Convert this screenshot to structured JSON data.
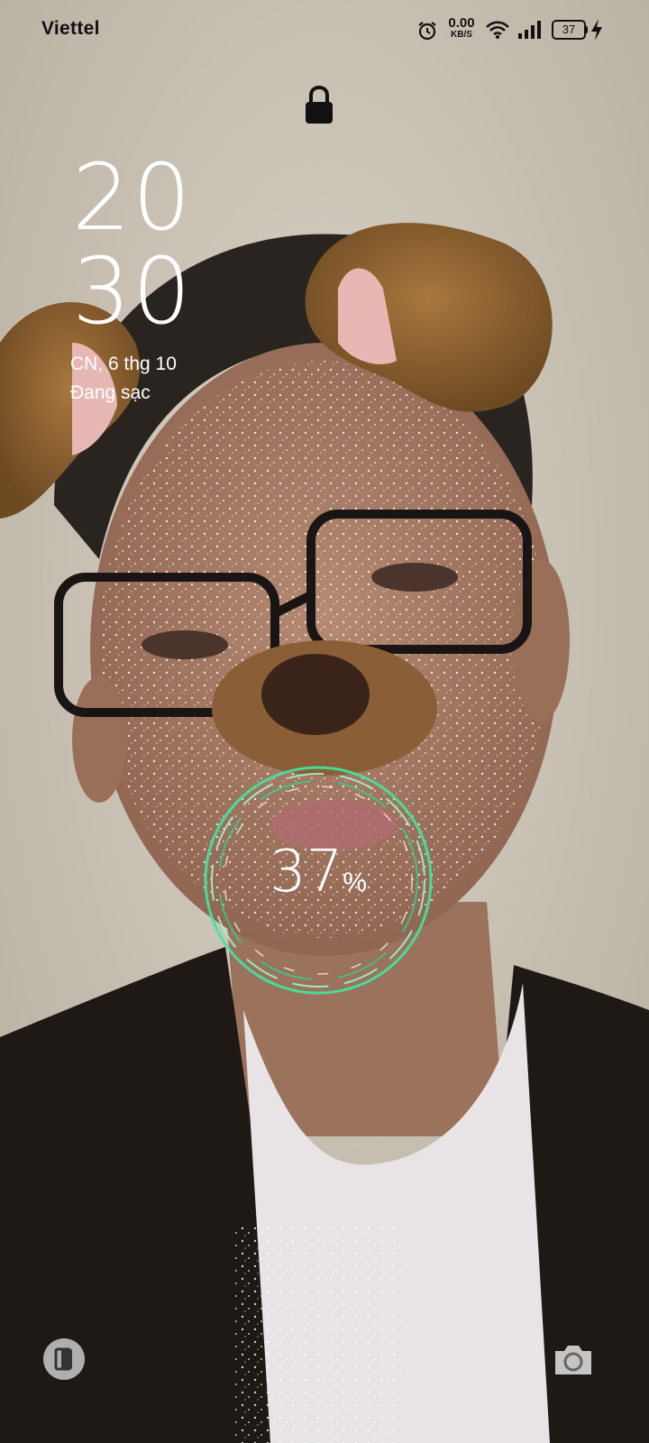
{
  "status_bar": {
    "carrier": "Viettel",
    "net_speed_value": "0.00",
    "net_speed_unit": "KB/S",
    "battery_level": "37",
    "icons": [
      "alarm-icon",
      "wifi-icon",
      "signal-icon",
      "battery-icon",
      "charging-bolt-icon"
    ]
  },
  "lock": {
    "icon": "lock-icon"
  },
  "clock": {
    "hours": "20",
    "minutes": "30"
  },
  "date": "CN,  6 thg 10",
  "charging_status": "Đang sạc",
  "charge": {
    "value": "37",
    "symbol": "%",
    "fraction": 0.37,
    "ring_color": "#3ee8a0"
  },
  "bottom": {
    "left_icon": "wallet-icon",
    "right_icon": "camera-icon"
  }
}
